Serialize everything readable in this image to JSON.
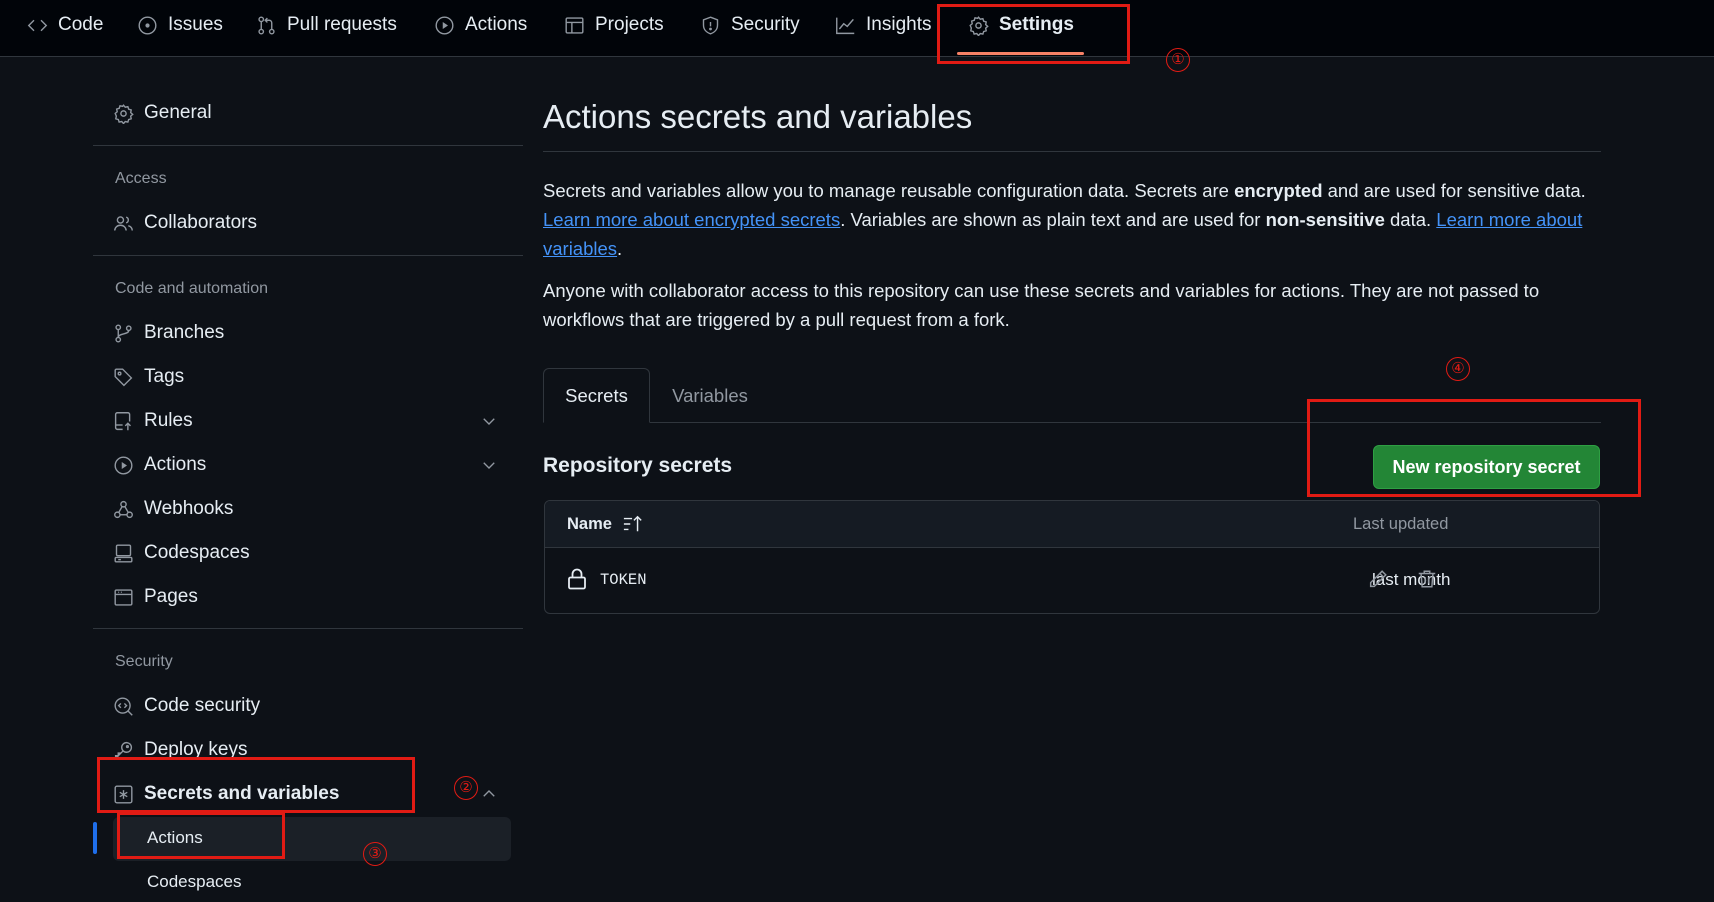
{
  "repo_nav": {
    "tabs": [
      {
        "label": "Code",
        "icon": "code-icon"
      },
      {
        "label": "Issues",
        "icon": "issue-opened-icon"
      },
      {
        "label": "Pull requests",
        "icon": "git-pull-request-icon"
      },
      {
        "label": "Actions",
        "icon": "play-icon"
      },
      {
        "label": "Projects",
        "icon": "table-icon"
      },
      {
        "label": "Security",
        "icon": "shield-icon"
      },
      {
        "label": "Insights",
        "icon": "graph-icon"
      },
      {
        "label": "Settings",
        "icon": "gear-icon",
        "active": true
      }
    ],
    "active_underline_color": "#f78166"
  },
  "sidebar": {
    "general": "General",
    "access": {
      "heading": "Access",
      "items": [
        "Collaborators"
      ]
    },
    "code_automation": {
      "heading": "Code and automation",
      "items": [
        "Branches",
        "Tags",
        "Rules",
        "Actions",
        "Webhooks",
        "Codespaces",
        "Pages"
      ]
    },
    "security": {
      "heading": "Security",
      "items": [
        "Code security",
        "Deploy keys",
        "Secrets and variables"
      ],
      "subitems": [
        "Actions",
        "Codespaces"
      ]
    }
  },
  "main": {
    "title": "Actions secrets and variables",
    "intro": {
      "p1_a": "Secrets and variables allow you to manage reusable configuration data. Secrets are ",
      "p1_b": "encrypted",
      "p1_c": " and are used for sensitive data. ",
      "p1_link1": "Learn more about encrypted secrets",
      "p1_d": ". Variables are shown as plain text and are used for ",
      "p1_e": "non-sensitive",
      "p1_f": " data. ",
      "p1_link2": "Learn more about variables",
      "p1_g": "."
    },
    "note": "Anyone with collaborator access to this repository can use these secrets and variables for actions. They are not passed to workflows that are triggered by a pull request from a fork.",
    "tabs": {
      "secrets": "Secrets",
      "variables": "Variables"
    },
    "section_heading": "Repository secrets",
    "new_button": "New repository secret",
    "button_color": "#238636",
    "table": {
      "col_name": "Name",
      "col_updated": "Last updated",
      "rows": [
        {
          "name": "TOKEN",
          "updated": "last month"
        }
      ]
    }
  },
  "annotations": {
    "numbers": [
      "①",
      "②",
      "③",
      "④"
    ],
    "color": "#e11b14"
  }
}
